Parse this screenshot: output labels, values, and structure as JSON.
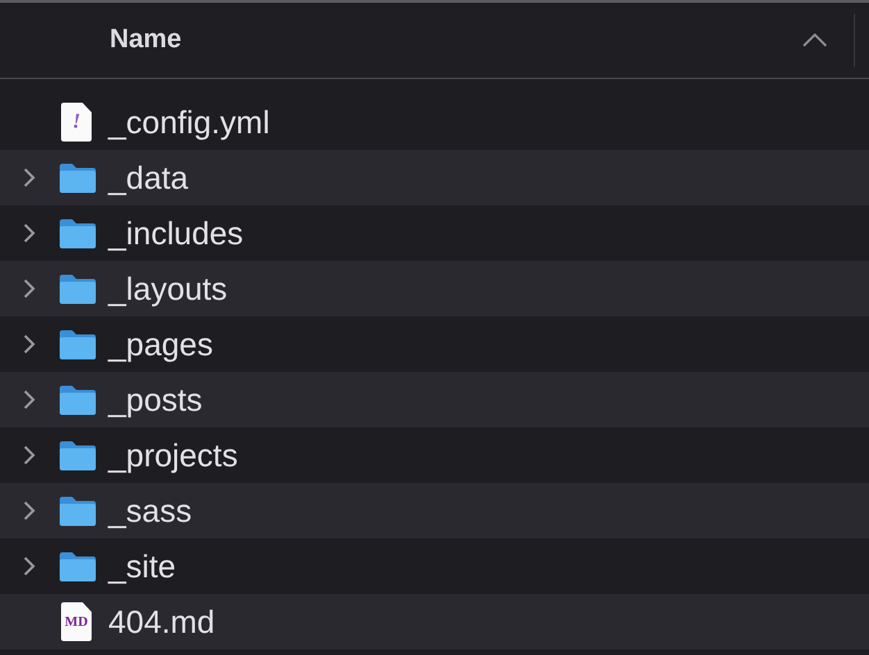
{
  "header": {
    "column": "Name",
    "sort_ascending": true
  },
  "files": [
    {
      "name": "_config.yml",
      "kind": "yaml",
      "icon_text": "!"
    },
    {
      "name": "_data",
      "kind": "folder",
      "expanded": false
    },
    {
      "name": "_includes",
      "kind": "folder",
      "expanded": false
    },
    {
      "name": "_layouts",
      "kind": "folder",
      "expanded": false
    },
    {
      "name": "_pages",
      "kind": "folder",
      "expanded": false
    },
    {
      "name": "_posts",
      "kind": "folder",
      "expanded": false
    },
    {
      "name": "_projects",
      "kind": "folder",
      "expanded": false
    },
    {
      "name": "_sass",
      "kind": "folder",
      "expanded": false
    },
    {
      "name": "_site",
      "kind": "folder",
      "expanded": false
    },
    {
      "name": "404.md",
      "kind": "markdown",
      "icon_text": "MD"
    }
  ]
}
